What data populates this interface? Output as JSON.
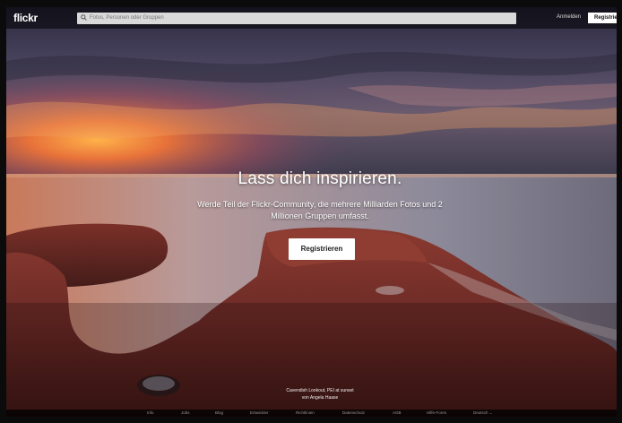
{
  "header": {
    "logo": "flickr",
    "search_placeholder": "Fotos, Personen oder Gruppen",
    "login_label": "Anmelden",
    "signup_label": "Registrieren"
  },
  "hero": {
    "title": "Lass dich inspirieren.",
    "subtitle": "Werde Teil der Flickr-Community, die mehrere Milliarden Fotos und 2 Millionen Gruppen umfasst.",
    "cta_label": "Registrieren",
    "photo_credit_title": "Cavendish Lookout, PEI at sunset",
    "photo_credit_author": "von Angela Haase"
  },
  "footer": {
    "links": [
      "Info",
      "Jobs",
      "Blog",
      "Entwickler",
      "Richtlinien",
      "Datenschutz",
      "AGB",
      "Hilfe-Foren",
      "Deutsch ⌄"
    ]
  },
  "colors": {
    "sky_top": "#4a4560",
    "sunset": "#e8823a",
    "rock": "#6b2a26",
    "water": "#a9a0a8"
  }
}
